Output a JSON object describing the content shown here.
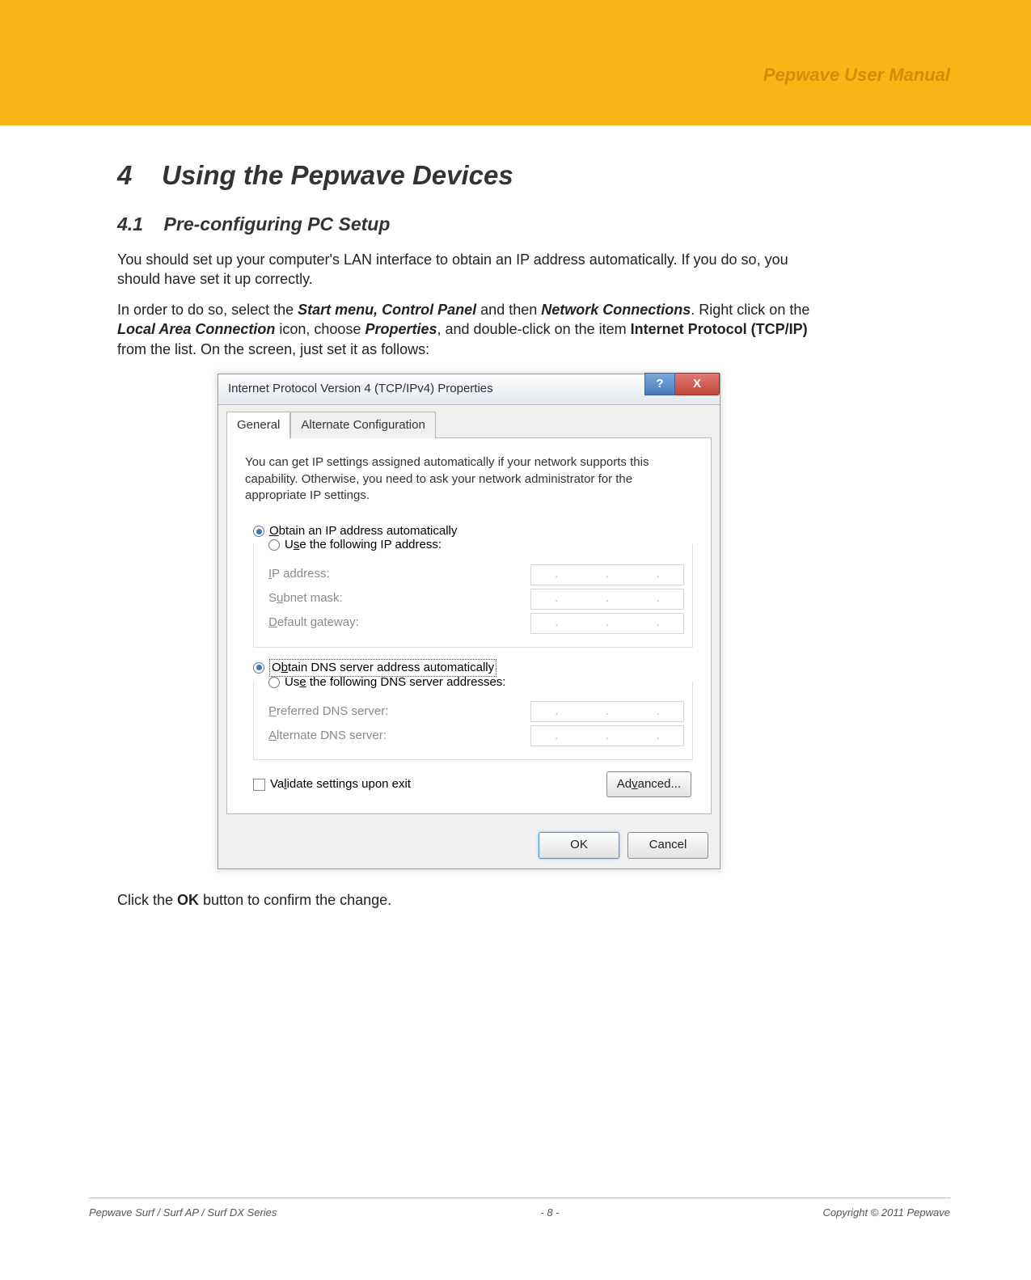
{
  "header": {
    "title": "Pepwave User Manual"
  },
  "section": {
    "num": "4",
    "title": "Using the Pepwave Devices",
    "sub_num": "4.1",
    "sub_title": "Pre-configuring PC Setup"
  },
  "body": {
    "p1": "You should set up your computer's LAN interface to obtain an IP address automatically.  If you do so, you should have set it up correctly.",
    "p2a": "In order to do so, select the ",
    "p2b": "Start menu, Control Panel",
    "p2c": " and then ",
    "p2d": "Network Connections",
    "p2e": ".  Right click on the ",
    "p2f": "Local Area Connection",
    "p2g": " icon, choose ",
    "p2h": "Properties",
    "p2i": ", and double-click on the item ",
    "p2j": "Internet Protocol (TCP/IP)",
    "p2k": " from the list.  On the screen, just set it as follows:",
    "p3a": "Click the ",
    "p3b": "OK",
    "p3c": " button to confirm the change."
  },
  "dialog": {
    "title": "Internet Protocol Version 4 (TCP/IPv4) Properties",
    "help": "?",
    "close": "X",
    "tabs": {
      "general": "General",
      "alt": "Alternate Configuration"
    },
    "desc": "You can get IP settings assigned automatically if your network supports this capability. Otherwise, you need to ask your network administrator for the appropriate IP settings.",
    "ip_auto_pre": "O",
    "ip_auto": "btain an IP address automatically",
    "ip_manual_pre": "U",
    "ip_manual_mid": "s",
    "ip_manual_post": "e the following IP address:",
    "ip_label_pre": "I",
    "ip_label": "P address:",
    "subnet_pre": "S",
    "subnet_mid": "u",
    "subnet_label": "bnet mask:",
    "gw_pre": "D",
    "gw_label": "efault gateway:",
    "dns_auto_pre": "O",
    "dns_auto_mid": "b",
    "dns_auto_post": "tain DNS server address automatically",
    "dns_manual_pre": "Us",
    "dns_manual_mid": "e",
    "dns_manual_post": " the following DNS server addresses:",
    "pref_pre": "P",
    "pref_label": "referred DNS server:",
    "alt_pre": "A",
    "alt_label": "lternate DNS server:",
    "validate_pre": "Va",
    "validate_mid": "l",
    "validate_post": "idate settings upon exit",
    "adv_pre": "Ad",
    "adv_mid": "v",
    "adv_post": "anced...",
    "ok": "OK",
    "cancel": "Cancel",
    "dot": "."
  },
  "footer": {
    "left": "Pepwave Surf / Surf AP / Surf DX Series",
    "center": "- 8 -",
    "right": "Copyright © 2011 Pepwave"
  }
}
